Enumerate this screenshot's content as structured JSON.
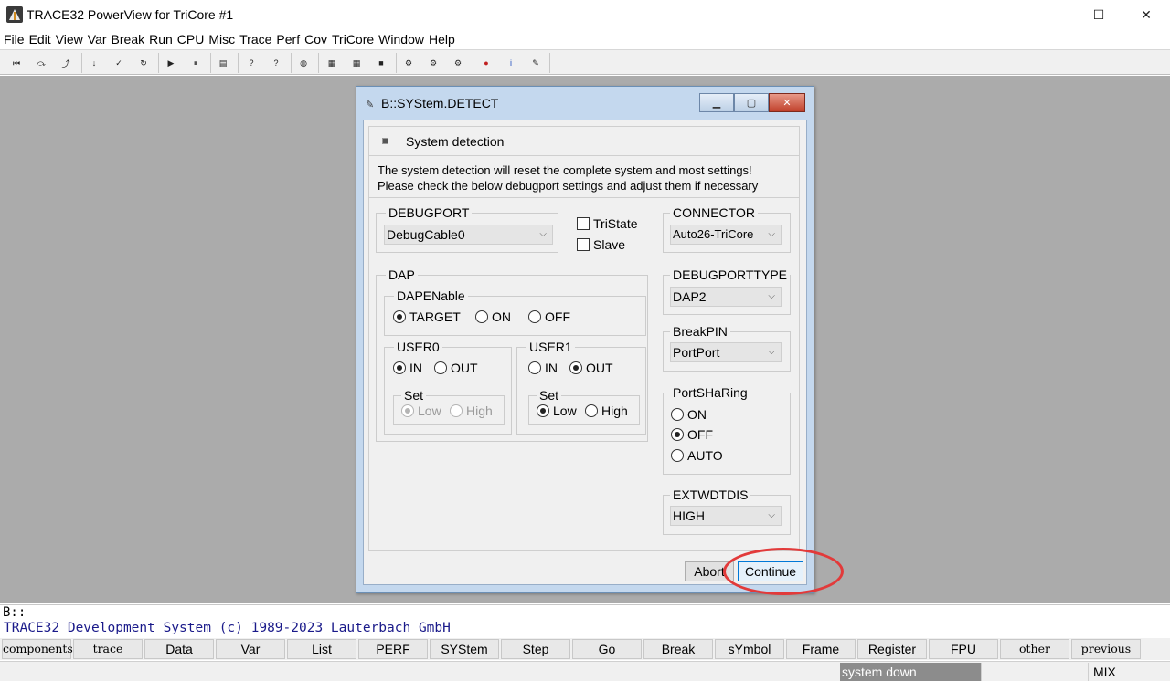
{
  "window": {
    "title": "TRACE32 PowerView for TriCore #1",
    "minimize": "—",
    "maximize": "☐",
    "close": "✕"
  },
  "menu": [
    "File",
    "Edit",
    "View",
    "Var",
    "Break",
    "Run",
    "CPU",
    "Misc",
    "Trace",
    "Perf",
    "Cov",
    "TriCore",
    "Window",
    "Help"
  ],
  "toolbar_icons": [
    "step-into-icon",
    "step-over-icon",
    "step-up-icon",
    "down-icon",
    "check-icon",
    "return-icon",
    "go-icon",
    "break-icon",
    "list-icon",
    "help-icon",
    "context-help-icon",
    "globe-icon",
    "window-icon",
    "register-icon",
    "stop-icon",
    "trace-icon",
    "trace-list-icon",
    "chart-icon",
    "bug-icon",
    "info-icon",
    "tool-icon"
  ],
  "dialog": {
    "title": "B::SYStem.DETECT",
    "min": "▁",
    "max": "▢",
    "close": "✕",
    "header": "System detection",
    "message_line1": "The system detection will reset the complete system and most settings!",
    "message_line2": "Please check the below debugport settings and adjust them if necessary",
    "debugport": {
      "label": "DEBUGPORT",
      "value": "DebugCable0"
    },
    "tristate": "TriState",
    "slave": "Slave",
    "connector": {
      "label": "CONNECTOR",
      "value": "Auto26-TriCore"
    },
    "dap": {
      "label": "DAP",
      "dapenable": {
        "label": "DAPENable",
        "options": [
          "TARGET",
          "ON",
          "OFF"
        ],
        "selected": "TARGET"
      },
      "user0": {
        "label": "USER0",
        "in": "IN",
        "out": "OUT",
        "selected": "IN",
        "set_label": "Set",
        "low": "Low",
        "high": "High",
        "set_selected": "Low"
      },
      "user1": {
        "label": "USER1",
        "in": "IN",
        "out": "OUT",
        "selected": "OUT",
        "set_label": "Set",
        "low": "Low",
        "high": "High",
        "set_selected": "Low"
      }
    },
    "debugporttype": {
      "label": "DEBUGPORTTYPE",
      "value": "DAP2"
    },
    "breakpin": {
      "label": "BreakPIN",
      "value": "PortPort"
    },
    "portsharing": {
      "label": "PortSHaRing",
      "options": [
        "ON",
        "OFF",
        "AUTO"
      ],
      "selected": "OFF"
    },
    "extwdtdis": {
      "label": "EXTWDTDIS",
      "value": "HIGH"
    },
    "abort": "Abort",
    "continue": "Continue"
  },
  "command": {
    "prompt": "B::",
    "message": "TRACE32 Development System (c) 1989-2023 Lauterbach GmbH"
  },
  "softkeys": [
    "components",
    "trace",
    "Data",
    "Var",
    "List",
    "PERF",
    "SYStem",
    "Step",
    "Go",
    "Break",
    "sYmbol",
    "Frame",
    "Register",
    "FPU",
    "other",
    "previous"
  ],
  "status": {
    "state": "system down",
    "mode": "MIX"
  },
  "colors": {
    "desktop": "#ababab",
    "dialog_frame": "#c4d8ee",
    "highlight": "#e23a3a",
    "status_bg": "#8c8c8c"
  }
}
